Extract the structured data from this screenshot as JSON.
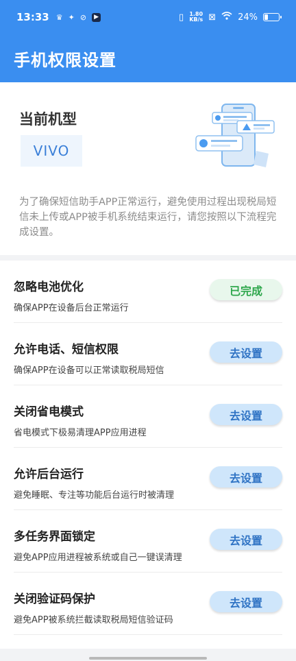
{
  "status_bar": {
    "time": "13:33",
    "net_speed_value": "1.80",
    "net_speed_unit": "KB/s",
    "battery": "24%",
    "battery_level": 0.24
  },
  "appbar": {
    "title": "手机权限设置"
  },
  "device": {
    "label": "当前机型",
    "model": "VIVO",
    "description": "为了确保短信助手APP正常运行，避免使用过程出现税局短信未上传或APP被手机系统结束运行，请您按照以下流程完成设置。"
  },
  "items": [
    {
      "title": "忽略电池优化",
      "subtitle": "确保APP在设备后台正常运行",
      "button": "已完成",
      "status": "done"
    },
    {
      "title": "允许电话、短信权限",
      "subtitle": "确保APP在设备可以正常读取税局短信",
      "button": "去设置",
      "status": "todo"
    },
    {
      "title": "关闭省电模式",
      "subtitle": "省电模式下极易清理APP应用进程",
      "button": "去设置",
      "status": "todo"
    },
    {
      "title": "允许后台运行",
      "subtitle": "避免睡眠、专注等功能后台运行时被清理",
      "button": "去设置",
      "status": "todo"
    },
    {
      "title": "多任务界面锁定",
      "subtitle": "避免APP应用进程被系统或自己一键误清理",
      "button": "去设置",
      "status": "todo"
    },
    {
      "title": "关闭验证码保护",
      "subtitle": "避免APP被系统拦截读取税局短信验证码",
      "button": "去设置",
      "status": "todo"
    }
  ],
  "colors": {
    "primary": "#3a8ef0",
    "done_text": "#2ea74c",
    "go_text": "#2f73c4"
  }
}
